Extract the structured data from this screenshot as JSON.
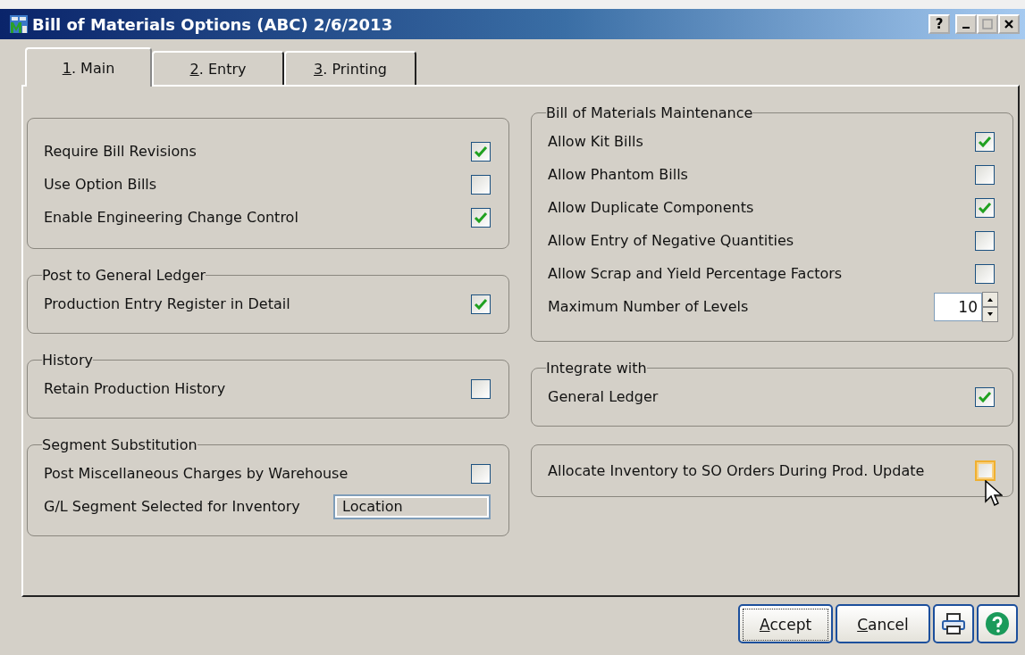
{
  "window": {
    "title": "Bill of Materials Options (ABC) 2/6/2013",
    "help_button": "?"
  },
  "tabs": [
    {
      "hotkey": "1",
      "label": ". Main",
      "selected": true
    },
    {
      "hotkey": "2",
      "label": ". Entry",
      "selected": false
    },
    {
      "hotkey": "3",
      "label": ". Printing",
      "selected": false
    }
  ],
  "left_groups": [
    {
      "rows": [
        {
          "kind": "checkbox",
          "label": "Require Bill Revisions",
          "checked": true,
          "hovered": false
        },
        {
          "kind": "checkbox",
          "label": "Use Option Bills",
          "checked": false,
          "hovered": false
        },
        {
          "kind": "checkbox",
          "label": "Enable Engineering Change Control",
          "checked": true,
          "hovered": false
        }
      ]
    },
    {
      "title": "Post to General Ledger",
      "rows": [
        {
          "kind": "checkbox",
          "label": "Production Entry Register in Detail",
          "checked": true,
          "hovered": false
        }
      ]
    },
    {
      "title": "History",
      "rows": [
        {
          "kind": "checkbox",
          "label": "Retain Production History",
          "checked": false,
          "hovered": false
        }
      ]
    },
    {
      "title": "Segment Substitution",
      "rows": [
        {
          "kind": "checkbox",
          "label": "Post Miscellaneous Charges by Warehouse",
          "checked": false,
          "hovered": false
        },
        {
          "kind": "field",
          "label": "G/L Segment Selected for Inventory",
          "value": "Location"
        }
      ]
    }
  ],
  "right_groups": [
    {
      "title": "Bill of Materials Maintenance",
      "rows": [
        {
          "kind": "checkbox",
          "label": "Allow Kit Bills",
          "checked": true,
          "hovered": false
        },
        {
          "kind": "checkbox",
          "label": "Allow Phantom Bills",
          "checked": false,
          "hovered": false
        },
        {
          "kind": "checkbox",
          "label": "Allow Duplicate Components",
          "checked": true,
          "hovered": false
        },
        {
          "kind": "checkbox",
          "label": "Allow Entry of Negative Quantities",
          "checked": false,
          "hovered": false
        },
        {
          "kind": "checkbox",
          "label": "Allow Scrap and Yield Percentage Factors",
          "checked": false,
          "hovered": false
        },
        {
          "kind": "spinner",
          "label": "Maximum Number of Levels",
          "value": "10"
        }
      ]
    },
    {
      "title": "Integrate with",
      "rows": [
        {
          "kind": "checkbox",
          "label": "General Ledger",
          "checked": true,
          "hovered": false
        }
      ]
    },
    {
      "rows": [
        {
          "kind": "checkbox",
          "label": "Allocate Inventory to SO Orders During Prod. Update",
          "checked": false,
          "hovered": true
        }
      ]
    }
  ],
  "buttons": [
    {
      "hotkey": "A",
      "label": "ccept",
      "focused": true
    },
    {
      "hotkey": "C",
      "label": "ancel",
      "focused": false
    }
  ]
}
